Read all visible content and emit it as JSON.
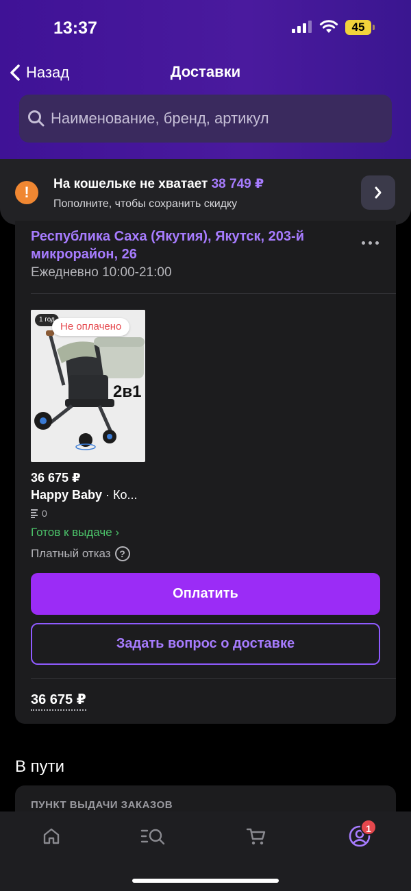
{
  "status": {
    "time": "13:37",
    "battery": "45"
  },
  "nav": {
    "back_label": "Назад",
    "title": "Доставки"
  },
  "search": {
    "placeholder": "Наименование, бренд, артикул"
  },
  "wallet": {
    "title": "На кошельке не хватает",
    "amount": "38 749 ₽",
    "subtitle": "Пополните, чтобы сохранить скидку",
    "icon": "exclamation-icon"
  },
  "delivery": {
    "address": "Республика Саха (Якутия), Якутск, 203-й микрорайон, 26",
    "hours": "Ежедневно 10:00-21:00",
    "product": {
      "age_badge": "1 год",
      "status_badge": "Не оплачено",
      "image_label": "2в1",
      "price": "36 675 ₽",
      "brand": "Happy Baby",
      "name_suffix": "· Ко...",
      "rating_count": "0",
      "ready": "Готов к выдаче ›",
      "paid_refusal": "Платный отказ",
      "help_symbol": "?"
    },
    "pay_button": "Оплатить",
    "ask_button": "Задать вопрос о доставке",
    "total": "36 675 ₽"
  },
  "in_transit": {
    "title": "В пути",
    "card_label": "ПУНКТ ВЫДАЧИ ЗАКАЗОВ"
  },
  "tabbar": {
    "items": [
      {
        "icon": "home-icon"
      },
      {
        "icon": "catalog-search-icon"
      },
      {
        "icon": "cart-icon"
      },
      {
        "icon": "profile-icon",
        "badge": "1"
      }
    ]
  },
  "colors": {
    "header": "#4a1a9e",
    "accent": "#9b2cf6",
    "link": "#a77cff",
    "success": "#4cc36a",
    "warning": "#f08732",
    "danger": "#e5484d"
  }
}
